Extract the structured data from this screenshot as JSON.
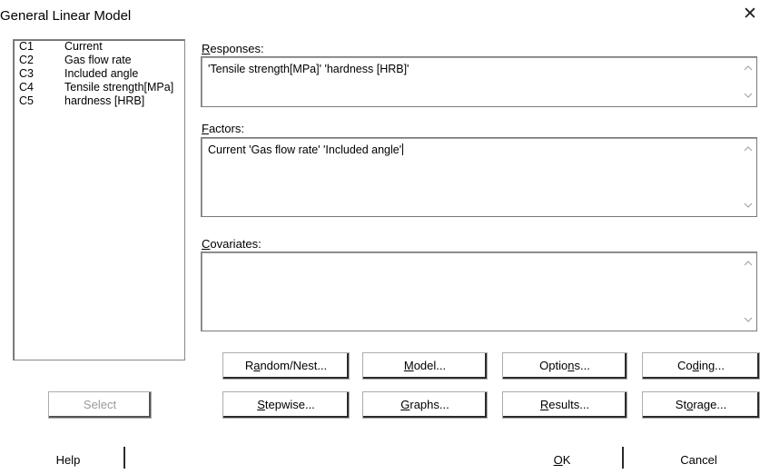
{
  "window": {
    "title": "General Linear Model",
    "close_glyph": "✕"
  },
  "variables": [
    {
      "col": "C1",
      "name": "Current"
    },
    {
      "col": "C2",
      "name": "Gas flow rate"
    },
    {
      "col": "C3",
      "name": "Included angle"
    },
    {
      "col": "C4",
      "name": "Tensile strength[MPa]"
    },
    {
      "col": "C5",
      "name": "hardness [HRB]"
    }
  ],
  "responses": {
    "label_u": "R",
    "label_rest": "esponses:",
    "value": "'Tensile strength[MPa]' 'hardness [HRB]'"
  },
  "factors": {
    "label_u": "F",
    "label_rest": "actors:",
    "value": "Current 'Gas flow rate' 'Included angle'"
  },
  "covariates": {
    "label_u": "C",
    "label_rest": "ovariates:",
    "value": ""
  },
  "buttons": {
    "select": "Select",
    "help": "Help",
    "random_nest": {
      "pre": "R",
      "u": "a",
      "post": "ndom/Nest..."
    },
    "model": {
      "pre": "",
      "u": "M",
      "post": "odel..."
    },
    "options": {
      "pre": "Optio",
      "u": "n",
      "post": "s..."
    },
    "coding": {
      "pre": "Co",
      "u": "d",
      "post": "ing..."
    },
    "stepwise": {
      "pre": "",
      "u": "S",
      "post": "tepwise..."
    },
    "graphs": {
      "pre": "",
      "u": "G",
      "post": "raphs..."
    },
    "results": {
      "pre": "",
      "u": "R",
      "post": "esults..."
    },
    "storage": {
      "pre": "St",
      "u": "o",
      "post": "rage..."
    },
    "ok": {
      "pre": "",
      "u": "O",
      "post": "K"
    },
    "cancel": "Cancel"
  }
}
